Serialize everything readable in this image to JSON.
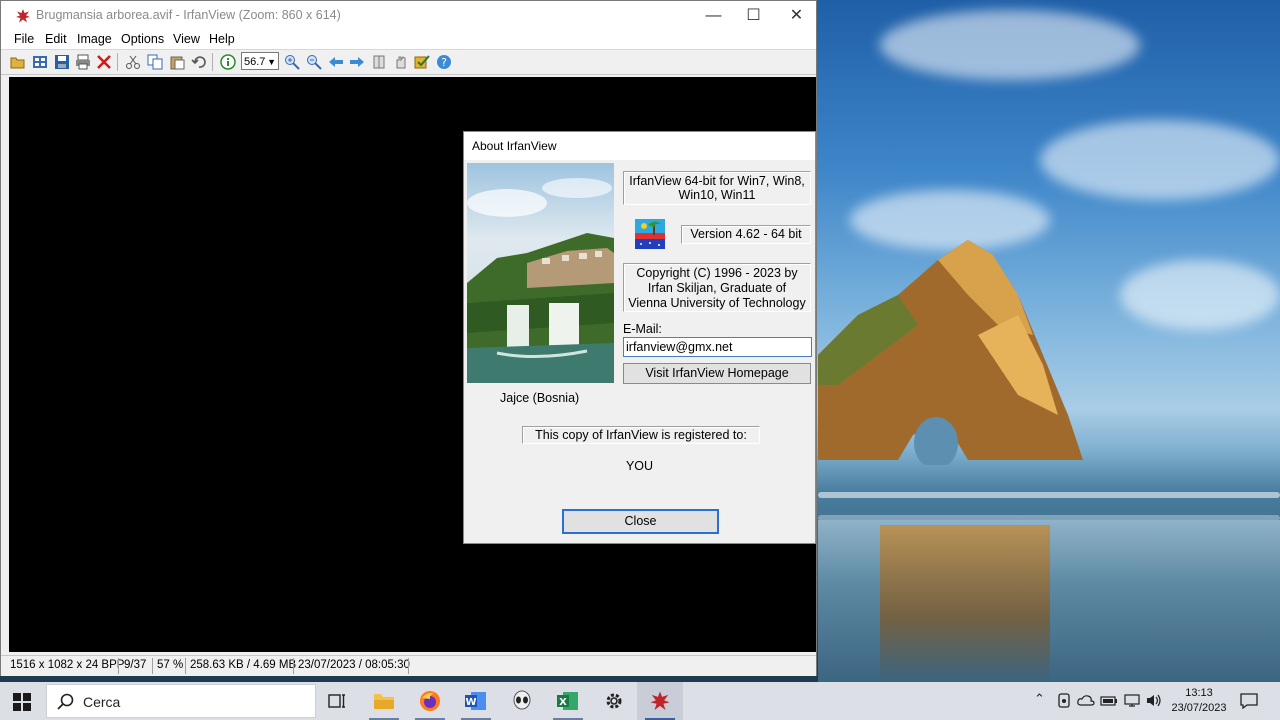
{
  "window": {
    "title": "Brugmansia arborea.avif - IrfanView (Zoom: 860 x 614)",
    "menu": [
      "File",
      "Edit",
      "Image",
      "Options",
      "View",
      "Help"
    ],
    "zoom_value": "56.7",
    "status": {
      "dims": "1516 x 1082 x 24 BPP",
      "index": "9/37",
      "zoom_pct": "57 %",
      "size": "258.63 KB / 4.69 MB",
      "date": "23/07/2023 / 08:05:30"
    }
  },
  "about": {
    "title": "About  IrfanView",
    "photo_caption": "Jajce (Bosnia)",
    "product_line1": "IrfanView 64-bit for Win7, Win8,",
    "product_line2": "Win10, Win11",
    "version": "Version 4.62 - 64 bit",
    "copyright_line1": "Copyright (C) 1996 - 2023 by",
    "copyright_line2": "Irfan Skiljan, Graduate of",
    "copyright_line3": "Vienna University of Technology",
    "email_label": "E-Mail:",
    "email_value": "irfanview@gmx.net",
    "visit_label": "Visit IrfanView Homepage",
    "registered_label": "This copy of IrfanView is registered to:",
    "registered_to": "YOU",
    "close_label": "Close"
  },
  "taskbar": {
    "search_placeholder": "Cerca",
    "time": "13:13",
    "date": "23/07/2023",
    "icons": [
      "task-view-icon",
      "file-explorer-icon",
      "firefox-icon",
      "word-icon",
      "alien-app-icon",
      "excel-icon",
      "settings-icon",
      "irfanview-icon"
    ]
  },
  "colors": {
    "accent": "#2a6fd6",
    "canvas": "#000000",
    "taskbar": "#dcdfe6"
  }
}
